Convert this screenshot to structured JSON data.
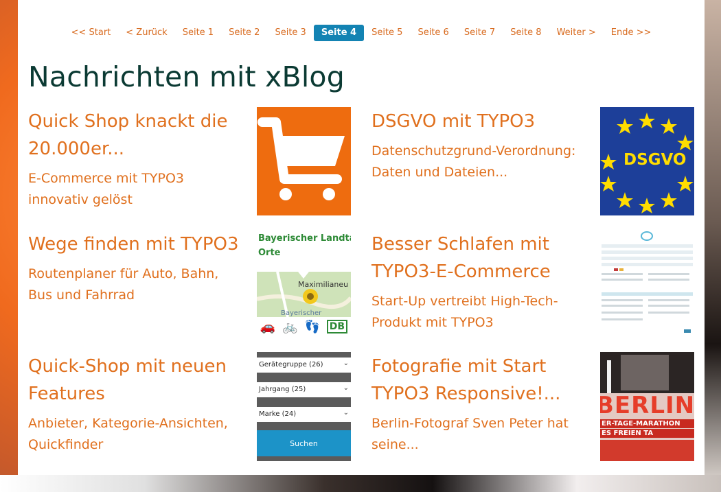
{
  "pagination": {
    "start": "<< Start",
    "prev": "< Zurück",
    "pages": [
      "Seite 1",
      "Seite 2",
      "Seite 3",
      "Seite 4",
      "Seite 5",
      "Seite 6",
      "Seite 7",
      "Seite 8"
    ],
    "active_page": "Seite 4",
    "next": "Weiter >",
    "end": "Ende >>"
  },
  "page_title": "Nachrichten mit xBlog",
  "colors": {
    "link": "#e0701e",
    "title": "#0b3a33",
    "active_page_bg": "#1383b3"
  },
  "posts": [
    {
      "title": "Quick Shop knackt die 20.000er...",
      "teaser": "E-Commerce mit TYPO3 innovativ gelöst",
      "thumb_icon": "shopping-cart-icon"
    },
    {
      "title": "DSGVO mit TYPO3",
      "teaser": "Datenschutzgrund-Verordnung: Daten und Dateien...",
      "thumb_text": "DSGVO"
    },
    {
      "title": "Wege finden mit TYPO3",
      "teaser": "Routenplaner für Auto, Bahn, Bus und Fahrrad",
      "thumb_text_1": "Bayerischer Landta",
      "thumb_text_2": "Orte",
      "thumb_text_3": "Maximilianeu",
      "thumb_text_4": "Bayerischer",
      "thumb_text_5": "DB"
    },
    {
      "title": "Besser Schlafen mit TYPO3-E-Commerce",
      "teaser": "Start-Up vertreibt High-Tech-Produkt mit TYPO3"
    },
    {
      "title": "Quick-Shop mit neuen Features",
      "teaser": "Anbieter, Kategorie-Ansichten, Quickfinder",
      "thumb_rows": [
        "Gerätegruppe (26)",
        "Jahrgang (25)",
        "Marke (24)"
      ],
      "thumb_button": "Suchen"
    },
    {
      "title": "Fotografie mit Start TYPO3 Responsive!...",
      "teaser": "Berlin-Fotograf Sven Peter hat seine...",
      "thumb_text_1": "BERLIN",
      "thumb_text_2": "ER-TAGE-MARATHON",
      "thumb_text_3": "ES FREIEN TA"
    }
  ]
}
